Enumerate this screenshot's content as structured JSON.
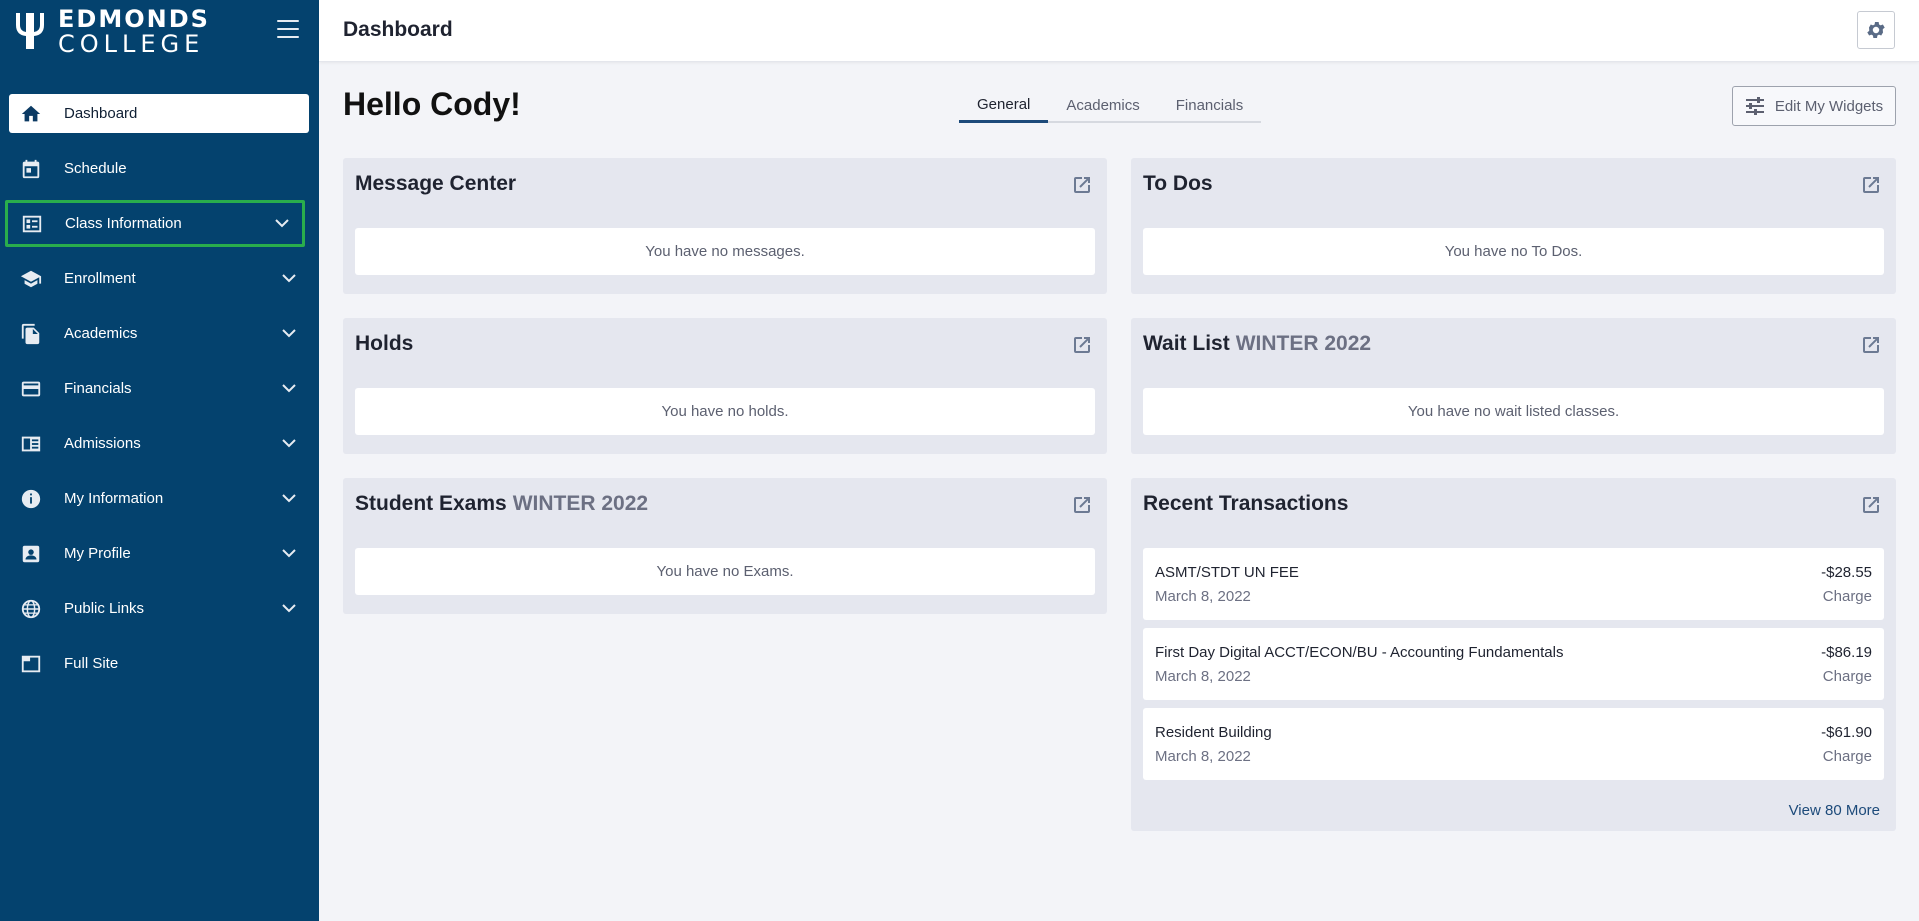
{
  "brand": {
    "line1": "EDMONDS",
    "line2": "COLLEGE"
  },
  "header": {
    "title": "Dashboard"
  },
  "sidebar": {
    "items": [
      {
        "label": "Dashboard",
        "icon": "home-icon"
      },
      {
        "label": "Schedule",
        "icon": "calendar-icon"
      },
      {
        "label": "Class Information",
        "icon": "class-info-icon"
      },
      {
        "label": "Enrollment",
        "icon": "graduation-cap-icon"
      },
      {
        "label": "Academics",
        "icon": "documents-icon"
      },
      {
        "label": "Financials",
        "icon": "credit-card-icon"
      },
      {
        "label": "Admissions",
        "icon": "admissions-icon"
      },
      {
        "label": "My Information",
        "icon": "info-icon"
      },
      {
        "label": "My Profile",
        "icon": "profile-icon"
      },
      {
        "label": "Public Links",
        "icon": "globe-icon"
      },
      {
        "label": "Full Site",
        "icon": "window-icon"
      }
    ]
  },
  "main": {
    "greeting": "Hello Cody!",
    "tabs": [
      {
        "label": "General"
      },
      {
        "label": "Academics"
      },
      {
        "label": "Financials"
      }
    ],
    "edit_widgets_label": "Edit My Widgets"
  },
  "widgets": {
    "message_center": {
      "title": "Message Center",
      "empty": "You have no messages."
    },
    "todos": {
      "title": "To Dos",
      "empty": "You have no To Dos."
    },
    "holds": {
      "title": "Holds",
      "empty": "You have no holds."
    },
    "wait_list": {
      "title": "Wait List",
      "term": "WINTER 2022",
      "empty": "You have no wait listed classes."
    },
    "student_exams": {
      "title": "Student Exams",
      "term": "WINTER 2022",
      "empty": "You have no Exams."
    },
    "recent_transactions": {
      "title": "Recent Transactions",
      "items": [
        {
          "description": "ASMT/STDT UN FEE",
          "date": "March 8, 2022",
          "amount": "-$28.55",
          "type": "Charge"
        },
        {
          "description": "First Day Digital ACCT/ECON/BU - Accounting Fundamentals",
          "date": "March 8, 2022",
          "amount": "-$86.19",
          "type": "Charge"
        },
        {
          "description": "Resident Building",
          "date": "March 8, 2022",
          "amount": "-$61.90",
          "type": "Charge"
        }
      ],
      "more_label": "View 80 More"
    }
  },
  "colors": {
    "sidebar_bg": "#04426e",
    "highlight": "#2aad4c",
    "accent": "#1c4a7a"
  }
}
